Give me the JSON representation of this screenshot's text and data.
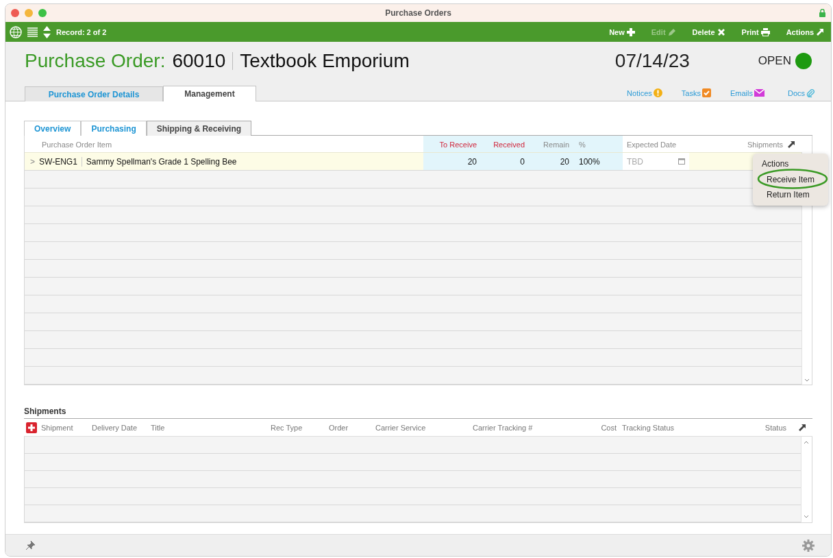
{
  "window": {
    "title": "Purchase Orders"
  },
  "toolbar": {
    "record": "Record: 2 of 2",
    "buttons": [
      {
        "label": "New",
        "disabled": false
      },
      {
        "label": "Edit",
        "disabled": true
      },
      {
        "label": "Delete",
        "disabled": false
      },
      {
        "label": "Print",
        "disabled": false
      },
      {
        "label": "Actions",
        "disabled": false
      }
    ]
  },
  "header": {
    "label": "Purchase Order:",
    "number": "60010",
    "vendor": "Textbook Emporium",
    "date": "07/14/23",
    "status": {
      "label": "OPEN",
      "color": "#1e9a10"
    }
  },
  "tabs": [
    {
      "label": "Purchase Order Details",
      "selected": false
    },
    {
      "label": "Management",
      "selected": true
    }
  ],
  "links": [
    "Notices",
    "Tasks",
    "Emails",
    "Docs"
  ],
  "subtabs": [
    {
      "label": "Overview",
      "selected": false
    },
    {
      "label": "Purchasing",
      "selected": false
    },
    {
      "label": "Shipping & Receiving",
      "selected": true
    }
  ],
  "items_table": {
    "columns": [
      "Purchase Order Item",
      "To Receive",
      "Received",
      "Remain",
      "%",
      "Expected Date",
      "Shipments"
    ],
    "rows": [
      {
        "expander": ">",
        "sku": "SW-ENG1",
        "name": "Sammy Spellman's Grade 1 Spelling Bee",
        "to_receive": "20",
        "received": "0",
        "remain": "20",
        "percent": "100%",
        "expected_date": "TBD"
      }
    ]
  },
  "actions_menu": {
    "title": "Actions",
    "items": [
      {
        "label": "Receive Item",
        "highlighted": true
      },
      {
        "label": "Return Item",
        "highlighted": false
      }
    ]
  },
  "shipments": {
    "title": "Shipments",
    "columns": [
      "Shipment",
      "Delivery Date",
      "Title",
      "Rec Type",
      "Order",
      "Carrier Service",
      "Carrier Tracking #",
      "Cost",
      "Tracking Status",
      "Status"
    ]
  }
}
